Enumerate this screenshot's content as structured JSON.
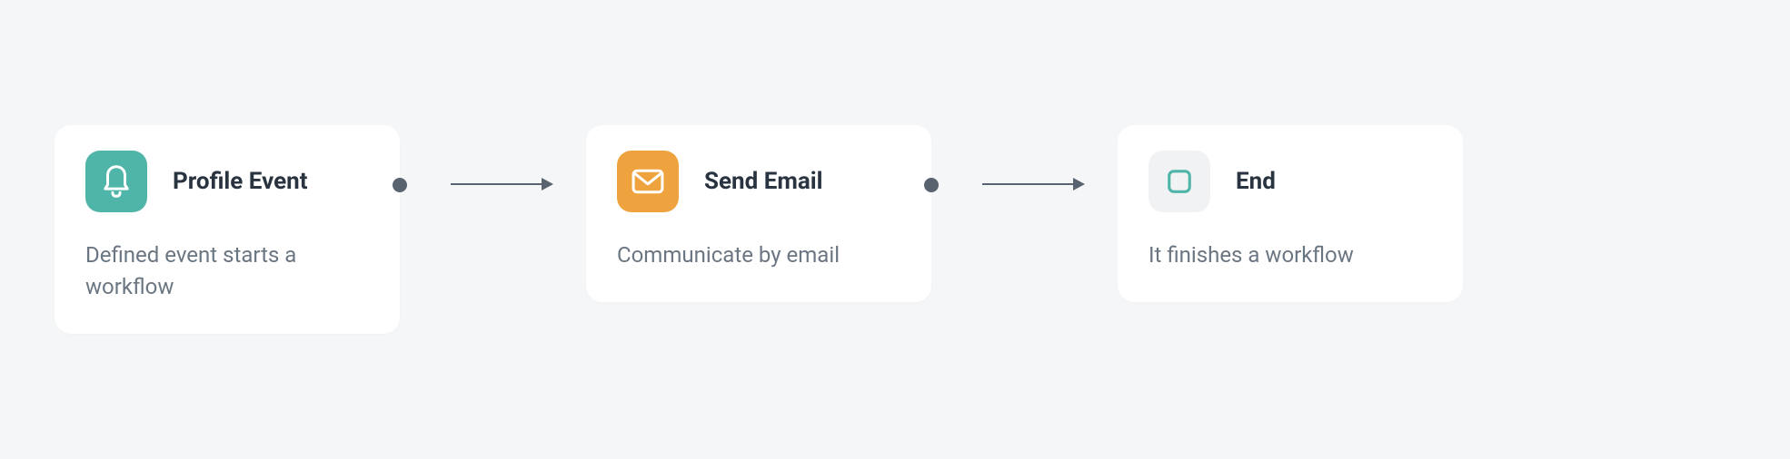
{
  "workflow": {
    "nodes": [
      {
        "id": "profile-event",
        "title": "Profile Event",
        "description": "Defined event starts a workflow",
        "icon": "bell-icon",
        "iconColor": "#ffffff",
        "iconBg": "#4fb5a8"
      },
      {
        "id": "send-email",
        "title": "Send Email",
        "description": "Communicate by email",
        "icon": "mail-icon",
        "iconColor": "#ffffff",
        "iconBg": "#efa33f"
      },
      {
        "id": "end",
        "title": "End",
        "description": "It finishes a workflow",
        "icon": "square-icon",
        "iconColor": "#4fb5a8",
        "iconBg": "#f0f2f4"
      }
    ]
  }
}
